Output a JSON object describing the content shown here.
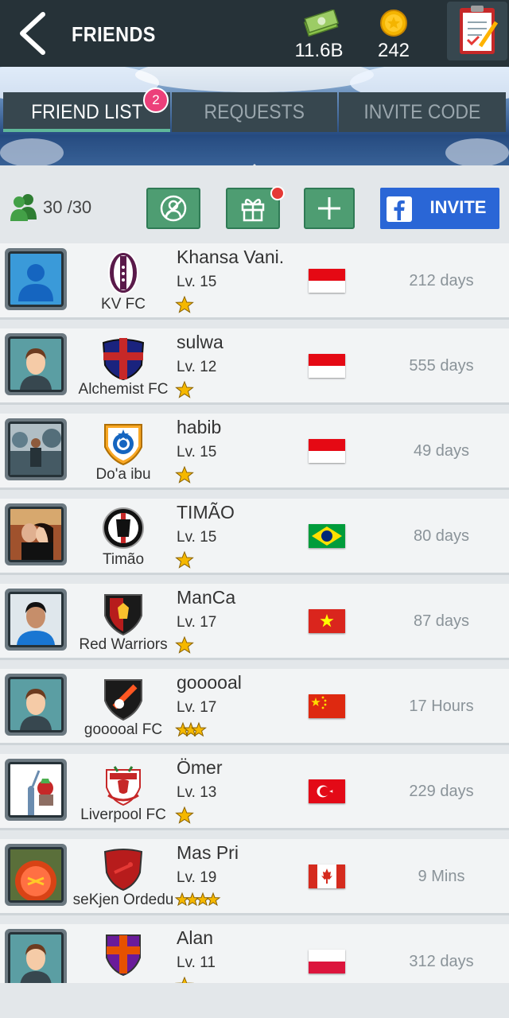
{
  "header": {
    "title": "FRIENDS",
    "cash": "11.6B",
    "coins": "242"
  },
  "tabs": [
    {
      "label": "FRIEND LIST",
      "badge": "2",
      "active": true
    },
    {
      "label": "REQUESTS",
      "active": false
    },
    {
      "label": "INVITE CODE",
      "active": false
    }
  ],
  "friends_count": "30 /30",
  "invite_label": "INVITE",
  "friends": [
    {
      "name": "Khansa Vani.",
      "level": "Lv.  15",
      "club": "KV FC",
      "stars": 1,
      "flag": "indonesia",
      "time": "212 days",
      "avatar": "default",
      "crest": "kv"
    },
    {
      "name": "sulwa",
      "level": "Lv.  12",
      "club": "Alchemist FC",
      "stars": 1,
      "flag": "indonesia",
      "time": "555 days",
      "avatar": "face",
      "crest": "alchemist"
    },
    {
      "name": "habib",
      "level": "Lv.  15",
      "club": "Do'a ibu",
      "stars": 1,
      "flag": "indonesia",
      "time": "49 days",
      "avatar": "photo-street",
      "crest": "chelsea"
    },
    {
      "name": "TIMÃO",
      "level": "Lv.  15",
      "club": "Timão",
      "stars": 1,
      "flag": "brazil",
      "time": "80 days",
      "avatar": "photo-couple",
      "crest": "corinthians"
    },
    {
      "name": "ManCa",
      "level": "Lv.  17",
      "club": "Red Warriors",
      "stars": 1,
      "flag": "vietnam",
      "time": "87 days",
      "avatar": "photo-man",
      "crest": "redwarriors"
    },
    {
      "name": "gooooal",
      "level": "Lv.  17",
      "club": "gooooal FC",
      "stars": 3,
      "flag": "china",
      "time": "17 Hours",
      "avatar": "face",
      "crest": "gooooal"
    },
    {
      "name": "Ömer",
      "level": "Lv.  13",
      "club": "Liverpool FC",
      "stars": 1,
      "flag": "turkey",
      "time": "229 days",
      "avatar": "photo-liberty",
      "crest": "liverpool"
    },
    {
      "name": "Mas Pri",
      "level": "Lv.  19",
      "club": "seKjen Ordedu",
      "stars": 4,
      "flag": "canada",
      "time": "9 Mins",
      "avatar": "photo-emblem",
      "crest": "sekjen"
    },
    {
      "name": "Alan",
      "level": "Lv.  11",
      "club": "",
      "stars": 1,
      "flag": "poland",
      "time": "312 days",
      "avatar": "face",
      "crest": "alan"
    }
  ],
  "colors": {
    "topbar": "#263238",
    "tab_bg": "#37474f",
    "tab_active_underline": "#5fb79a",
    "action_green": "#4e9d72",
    "facebook_blue": "#2a66d6",
    "badge_pink": "#ec407a",
    "time_gray": "#8a9399"
  }
}
